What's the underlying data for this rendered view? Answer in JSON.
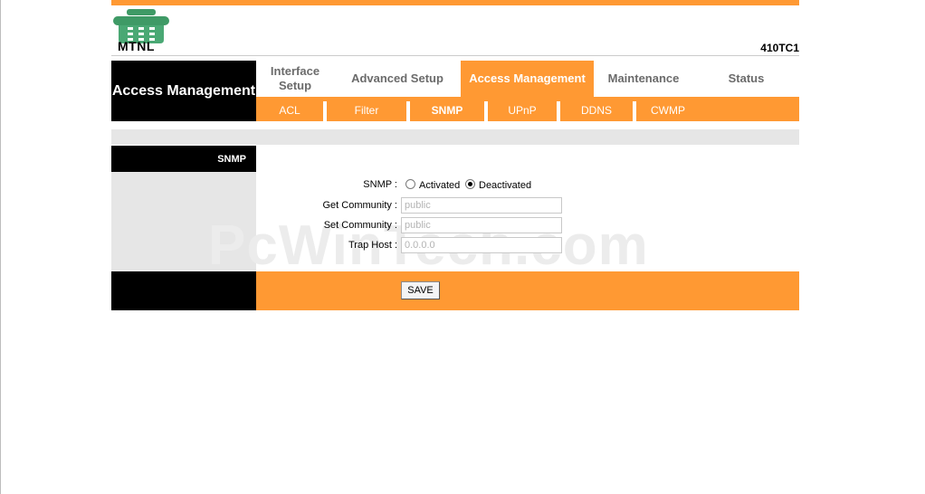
{
  "brand": {
    "logo_text": "MTNL",
    "model": "410TC1"
  },
  "section_title": "Access Management",
  "tabs": [
    {
      "label": "Interface Setup",
      "active": false
    },
    {
      "label": "Advanced Setup",
      "active": false
    },
    {
      "label": "Access Management",
      "active": true
    },
    {
      "label": "Maintenance",
      "active": false
    },
    {
      "label": "Status",
      "active": false
    }
  ],
  "subtabs": [
    {
      "label": "ACL",
      "active": false
    },
    {
      "label": "Filter",
      "active": false
    },
    {
      "label": "SNMP",
      "active": true
    },
    {
      "label": "UPnP",
      "active": false
    },
    {
      "label": "DDNS",
      "active": false
    },
    {
      "label": "CWMP",
      "active": false
    }
  ],
  "panel": {
    "title": "SNMP"
  },
  "form": {
    "snmp_label": "SNMP :",
    "option_activated": "Activated",
    "option_deactivated": "Deactivated",
    "snmp_state": "Deactivated",
    "get_community_label": "Get Community :",
    "get_community_value": "public",
    "set_community_label": "Set Community :",
    "set_community_value": "public",
    "trap_host_label": "Trap Host :",
    "trap_host_value": "0.0.0.0"
  },
  "save_label": "SAVE",
  "watermark": "PcWinTech.com",
  "colors": {
    "accent": "#ff9933",
    "dark": "#000000",
    "panel_gray": "#e6e6e6"
  }
}
